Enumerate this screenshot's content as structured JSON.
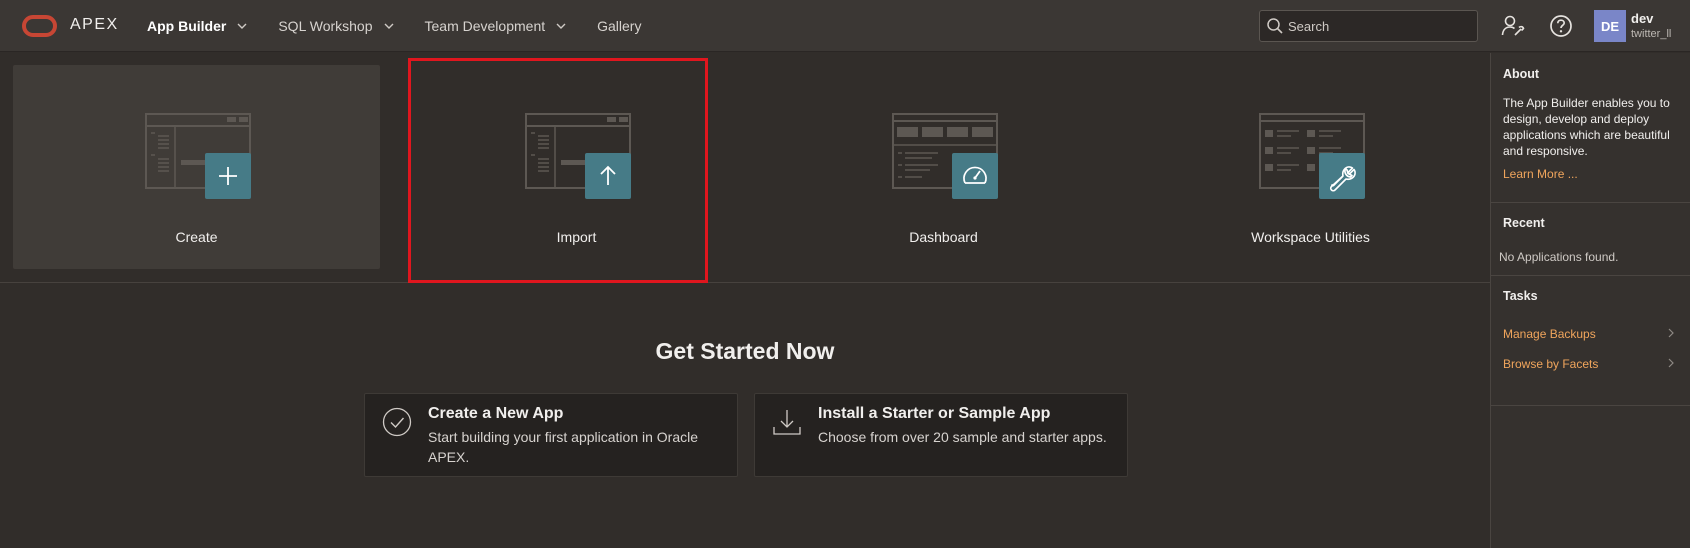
{
  "header": {
    "brand": "APEX",
    "nav": [
      {
        "label": "App Builder",
        "active": true,
        "dropdown": true
      },
      {
        "label": "SQL Workshop",
        "active": false,
        "dropdown": true
      },
      {
        "label": "Team Development",
        "active": false,
        "dropdown": true
      },
      {
        "label": "Gallery",
        "active": false,
        "dropdown": false
      }
    ],
    "search_placeholder": "Search",
    "user": {
      "initials": "DE",
      "name": "dev",
      "workspace": "twitter_ll"
    },
    "icons": [
      "user-settings-icon",
      "help-icon"
    ]
  },
  "cards": [
    {
      "label": "Create",
      "icon": "plus-icon"
    },
    {
      "label": "Import",
      "icon": "arrow-up-icon"
    },
    {
      "label": "Dashboard",
      "icon": "gauge-icon"
    },
    {
      "label": "Workspace Utilities",
      "icon": "wrench-icon"
    }
  ],
  "get_started": {
    "title": "Get Started Now",
    "items": [
      {
        "title": "Create a New App",
        "desc": "Start building your first application in Oracle APEX.",
        "icon": "checkmark-circle-icon"
      },
      {
        "title": "Install a Starter or Sample App",
        "desc": "Choose from over 20 sample and starter apps.",
        "icon": "download-icon"
      }
    ]
  },
  "sidebar": {
    "about": {
      "title": "About",
      "text": "The App Builder enables you to design, develop and deploy applications which are beautiful and responsive.",
      "link": "Learn More ..."
    },
    "recent": {
      "title": "Recent",
      "empty": "No Applications found."
    },
    "tasks": {
      "title": "Tasks",
      "items": [
        "Manage Backups",
        "Browse by Facets"
      ]
    }
  },
  "colors": {
    "background": "#312d2a",
    "header": "#3b3734",
    "accent_teal": "#467b87",
    "link_orange": "#f0a55c",
    "logo_red": "#c74634",
    "highlight_red": "#e0161e"
  }
}
